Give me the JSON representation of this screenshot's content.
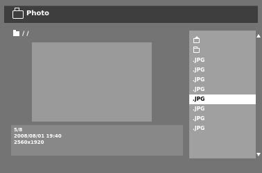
{
  "titlebar": {
    "title": "Photo",
    "icon": "camera-icon"
  },
  "path": {
    "text": "/ /",
    "icon": "folder-icon"
  },
  "info": {
    "counter": "5/8",
    "datetime": "2008/08/01 19:40",
    "resolution": "2560x1920"
  },
  "file_list": {
    "items": [
      {
        "type": "parent",
        "icon": "parent-folder-icon",
        "label": ""
      },
      {
        "type": "folder",
        "icon": "folder-icon",
        "label": ""
      },
      {
        "type": "file",
        "label": ".JPG"
      },
      {
        "type": "file",
        "label": ".JPG"
      },
      {
        "type": "file",
        "label": ".JPG"
      },
      {
        "type": "file",
        "label": ".JPG"
      },
      {
        "type": "file",
        "label": ".JPG",
        "selected": true
      },
      {
        "type": "file",
        "label": ".JPG"
      },
      {
        "type": "file",
        "label": ".JPG"
      },
      {
        "type": "file",
        "label": ".JPG"
      }
    ]
  },
  "colors": {
    "background": "#747474",
    "titlebar": "#3e3e3e",
    "list_panel": "#a0a0a0",
    "selected": "#ffffff"
  }
}
